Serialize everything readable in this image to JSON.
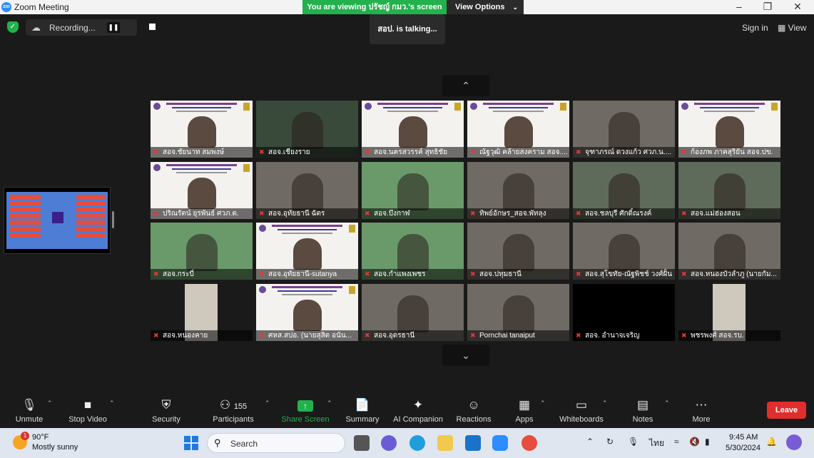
{
  "window": {
    "title": "Zoom Meeting",
    "logo": "zm"
  },
  "banner": {
    "viewing": "You are viewing ปรัชญ์ กมว.'s screen",
    "view_options": "View Options"
  },
  "topbar": {
    "recording": "Recording...",
    "talking": "สอป. is talking...",
    "sign_in": "Sign in",
    "view": "View"
  },
  "tiles": [
    {
      "name": "สอจ.ชัยนาท สมพงษ์",
      "kind": "slide"
    },
    {
      "name": "สอจ.เชียงราย",
      "kind": "office"
    },
    {
      "name": "สอจ.นครสวรรค์ สุทธิชัย",
      "kind": "slide"
    },
    {
      "name": "ณัฐวุฒิ คล้ายสงคราม สอจ....",
      "kind": "slide"
    },
    {
      "name": "จุฑาภรณ์ ดวงแก้ว ศวภ.น....",
      "kind": "person"
    },
    {
      "name": "ก้องภพ ภาคสุริยัน สอจ.ปข.",
      "kind": "slide"
    },
    {
      "name": "ปริณรัตน์ ยุรพันธ์ ศวภ.ต.",
      "kind": "slide"
    },
    {
      "name": "สอจ.อุทัยธานี ฉัตร",
      "kind": "person"
    },
    {
      "name": "สอจ.บึงกาฬ",
      "kind": "event"
    },
    {
      "name": "ทิพย์อักษร_สอจ.พัทลุง",
      "kind": "person"
    },
    {
      "name": "สอจ.ชลบุรี ศักดิ์ณรงค์",
      "kind": "room"
    },
    {
      "name": "สอจ.แม่ฮ่องสอน",
      "kind": "room"
    },
    {
      "name": "สอจ.กระบี่",
      "kind": "event"
    },
    {
      "name": "สอจ.อุทัยธานี-sutanya",
      "kind": "slide"
    },
    {
      "name": "สอจ.กำแพงเพชร",
      "kind": "event"
    },
    {
      "name": "สอจ.ปทุมธานี",
      "kind": "person"
    },
    {
      "name": "สอจ.สุโขทัย-ณัฐพิชช์ วงศ์ฝั้น",
      "kind": "person"
    },
    {
      "name": "สอจ.หนองบัวลำภู (นายกัม...",
      "kind": "person"
    },
    {
      "name": "สอจ.หนองคาย",
      "kind": "narrow"
    },
    {
      "name": "ศหส.สปอ. (นายสุสิต อนัน...",
      "kind": "slide"
    },
    {
      "name": "สอจ.อุดรธานี",
      "kind": "person"
    },
    {
      "name": "Pornchai tanaiput",
      "kind": "person"
    },
    {
      "name": "สอจ. อำนาจเจริญ",
      "kind": "black"
    },
    {
      "name": "พชรพงศ์ สอจ.รบ.",
      "kind": "narrow"
    }
  ],
  "toolbar": {
    "unmute": "Unmute",
    "stop_video": "Stop Video",
    "security": "Security",
    "participants": "Participants",
    "participants_count": "155",
    "share_screen": "Share Screen",
    "summary": "Summary",
    "ai_companion": "AI Companion",
    "reactions": "Reactions",
    "apps": "Apps",
    "whiteboards": "Whiteboards",
    "notes": "Notes",
    "more": "More",
    "leave": "Leave"
  },
  "taskbar": {
    "temp": "90°F",
    "condition": "Mostly sunny",
    "weather_badge": "1",
    "search_placeholder": "Search",
    "lang": "ไทย",
    "time": "9:45 AM",
    "date": "5/30/2024"
  },
  "colors": {
    "share_green": "#23b14d",
    "leave_red": "#e02d2d",
    "mic_red": "#e03b3b"
  }
}
